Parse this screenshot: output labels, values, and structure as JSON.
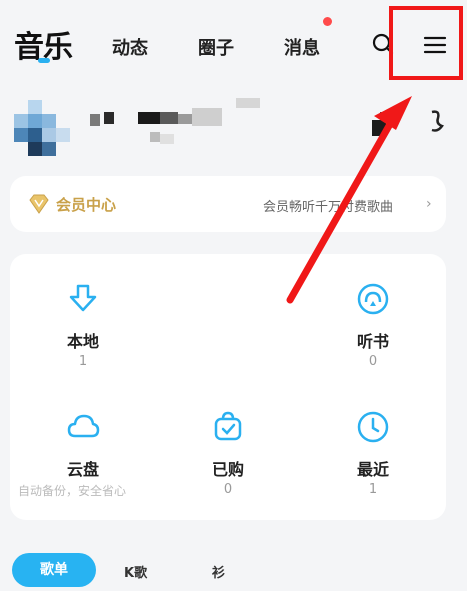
{
  "topnav": {
    "tabs": [
      "音乐",
      "动态",
      "圈子",
      "消息"
    ],
    "accent": "#2ab0f0",
    "notification_color": "#ff4b4b"
  },
  "vip": {
    "title": "会员中心",
    "subtitle": "会员畅听千万付费歌曲",
    "chevron": "›",
    "color": "#c9a14a"
  },
  "grid": {
    "items": [
      {
        "label": "本地",
        "count": "1",
        "icon": "download-icon"
      },
      {
        "label": "听书",
        "count": "0",
        "icon": "headphones-icon"
      },
      {
        "label": "云盘",
        "hint": "自动备份，安全省心",
        "icon": "cloud-icon"
      },
      {
        "label": "已购",
        "count": "0",
        "icon": "bag-icon"
      },
      {
        "label": "最近",
        "count": "1",
        "icon": "clock-icon"
      }
    ]
  },
  "bottom_tabs": [
    "歌单",
    "K歌",
    "衫"
  ],
  "annotation": {
    "color": "#f01818"
  }
}
